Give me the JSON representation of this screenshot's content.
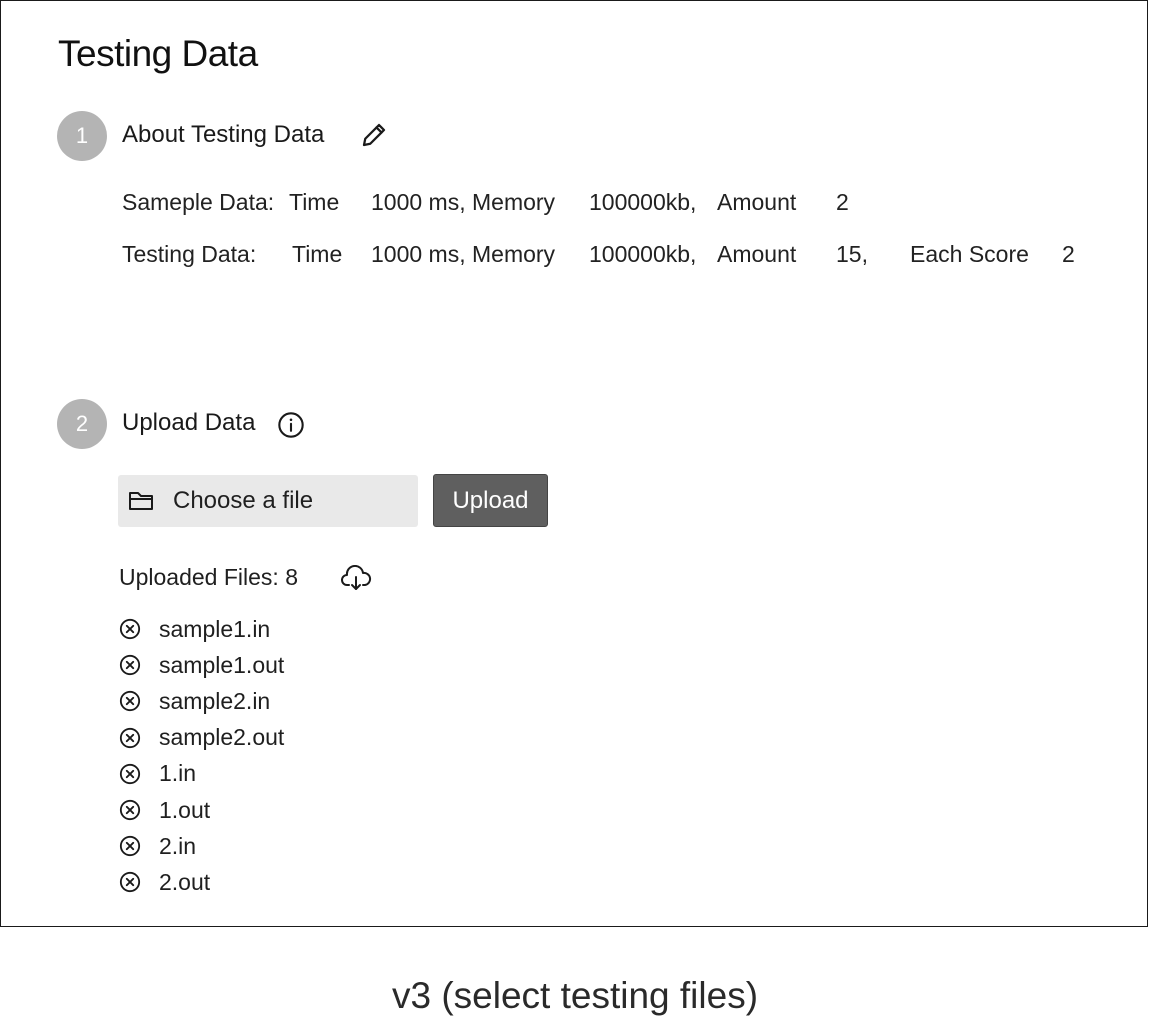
{
  "page": {
    "title": "Testing Data"
  },
  "step1": {
    "number": "1",
    "title": "About Testing Data",
    "edit_icon": "pencil-icon",
    "sample": {
      "label": "Sameple Data:",
      "time_label": "Time",
      "time_value": "1000 ms,",
      "memory_label": "Memory",
      "memory_value": "100000kb,",
      "amount_label": "Amount",
      "amount_value": "2"
    },
    "testing": {
      "label": "Testing Data:",
      "time_label": "Time",
      "time_value": "1000 ms,",
      "memory_label": "Memory",
      "memory_value": "100000kb,",
      "amount_label": "Amount",
      "amount_value": "15,",
      "score_label": "Each Score",
      "score_value": "2"
    }
  },
  "step2": {
    "number": "2",
    "title": "Upload Data",
    "info_icon": "info-icon",
    "chooser": {
      "icon": "folder-icon",
      "label": "Choose a file"
    },
    "upload_label": "Upload",
    "uploaded_label": "Uploaded Files: 8",
    "download_icon": "cloud-download-icon",
    "remove_icon": "close-circle-icon",
    "files": [
      "sample1.in",
      "sample1.out",
      "sample2.in",
      "sample2.out",
      "1.in",
      "1.out",
      "2.in",
      "2.out"
    ]
  },
  "caption": "v3 (select testing files)"
}
